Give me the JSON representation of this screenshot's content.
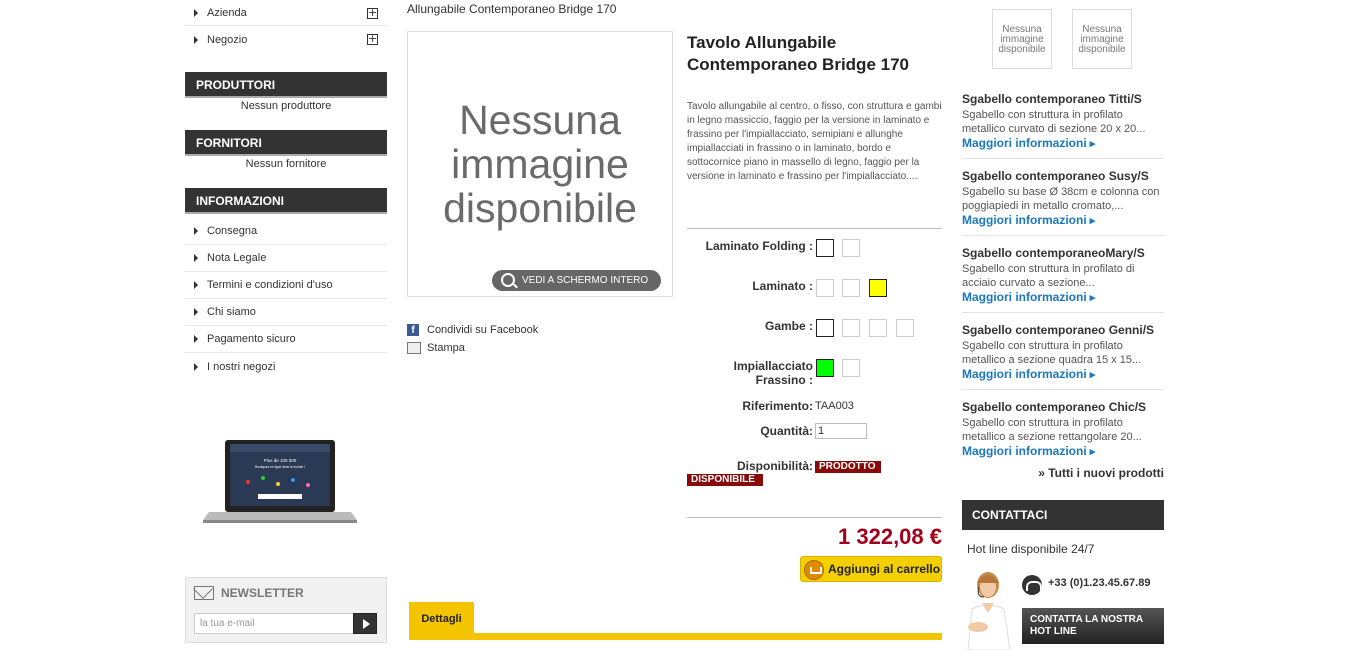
{
  "left": {
    "top_nav": [
      {
        "label": "Azienda"
      },
      {
        "label": "Negozio"
      }
    ],
    "manufacturers": {
      "title": "PRODUTTORI",
      "empty": "Nessun produttore"
    },
    "suppliers": {
      "title": "FORNITORI",
      "empty": "Nessun fornitore"
    },
    "info": {
      "title": "INFORMAZIONI",
      "items": [
        {
          "label": "Consegna"
        },
        {
          "label": "Nota Legale"
        },
        {
          "label": "Termini e condizioni d'uso"
        },
        {
          "label": "Chi siamo"
        },
        {
          "label": "Pagamento sicuro"
        },
        {
          "label": "I nostri negozi"
        }
      ]
    },
    "laptop_text": {
      "line1": "Plus de 100 000",
      "line2": "Boutiques en ligne dans le monde !"
    },
    "newsletter": {
      "title": "NEWSLETTER",
      "placeholder": "la tua e-mail"
    }
  },
  "product": {
    "breadcrumb": "Allungabile Contemporaneo Bridge 170",
    "no_image": "Nessuna immagine disponibile",
    "fullscreen_label": "VEDI A SCHERMO INTERO",
    "share_facebook": "Condividi su Facebook",
    "print": "Stampa",
    "title": "Tavolo Allungabile Contemporaneo Bridge 170",
    "description": "Tavolo allungabile al centro, o fisso, con struttura e gambi in legno massiccio, faggio per la versione in laminato e frassino per l'impiallacciato, semipiani e allunghe impiallacciati in frassino o in laminato, bordo e sottocornice piano in massello di legno, faggio per la versione in laminato e frassino per l'impiallacciato....",
    "attributes": [
      {
        "label": "Laminato Folding :",
        "swatches": [
          "#ffffff",
          "#ffffff"
        ],
        "selected": 0
      },
      {
        "label": "Laminato :",
        "swatches": [
          "#ffffff",
          "#ffffff",
          "#ffff00"
        ],
        "selected": 2
      },
      {
        "label": "Gambe :",
        "swatches": [
          "#ffffff",
          "#ffffff",
          "#ffffff",
          "#ffffff"
        ],
        "selected": 0
      },
      {
        "label": "Impiallacciato Frassino :",
        "swatches": [
          "#00ff00",
          "#ffffff"
        ],
        "selected": 0
      }
    ],
    "reference_label": "Riferimento:",
    "reference": "TAA003",
    "quantity_label": "Quantità:",
    "quantity": "1",
    "availability_label": "Disponibilità:",
    "availability_line1": "PRODOTTO",
    "availability_line2": "DISPONIBILE",
    "price": "1 322,08 €",
    "add_to_cart": "Aggiungi al carrello",
    "tab_details": "Dettagli"
  },
  "right": {
    "thumbs": [
      {
        "text": "Nessuna immagine disponibile"
      },
      {
        "text": "Nessuna immagine disponibile"
      }
    ],
    "new_products": [
      {
        "title": "Sgabello contemporaneo Titti/S",
        "desc": "Sgabello con struttura in profilato metallico curvato di sezione 20 x 20...",
        "more": "Maggiori informazioni"
      },
      {
        "title": "Sgabello contemporaneo Susy/S",
        "desc": "Sgabello su base Ø 38cm e colonna con poggiapiedi in metallo cromato,...",
        "more": "Maggiori informazioni"
      },
      {
        "title": "Sgabello contemporaneoMary/S",
        "desc": "Sgabello con struttura in profilato di acciaio curvato a sezione...",
        "more": "Maggiori informazioni"
      },
      {
        "title": "Sgabello contemporaneo Genni/S",
        "desc": "Sgabello con struttura in profilato metallico a sezione quadra 15 x 15...",
        "more": "Maggiori informazioni"
      },
      {
        "title": "Sgabello contemporaneo Chic/S",
        "desc": "Sgabello con struttura in profilato metallico a sezione rettangolare 20...",
        "more": "Maggiori informazioni"
      }
    ],
    "all_new": "» Tutti i nuovi prodotti",
    "contact": {
      "title": "CONTATTACI",
      "hotline": "Hot line disponibile 24/7",
      "phone": "+33 (0)1.23.45.67.89",
      "button_line1": "CONTATTA LA NOSTRA",
      "button_line2": "HOT LINE"
    }
  }
}
